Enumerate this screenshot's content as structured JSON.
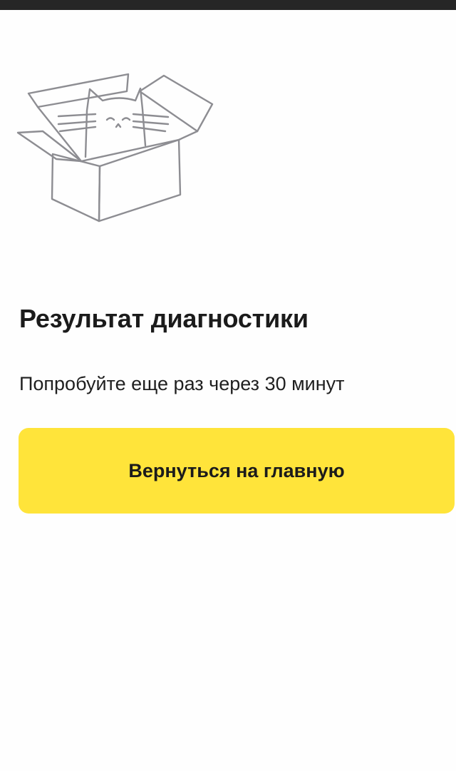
{
  "status_bar": {
    "color": "#262626"
  },
  "illustration": {
    "icon": "cat-in-box-icon"
  },
  "result": {
    "title": "Результат диагностики",
    "message": "Попробуйте еще раз через 30 минут"
  },
  "actions": {
    "back_home_label": "Вернуться на главную",
    "accent_color": "#ffe43a"
  }
}
